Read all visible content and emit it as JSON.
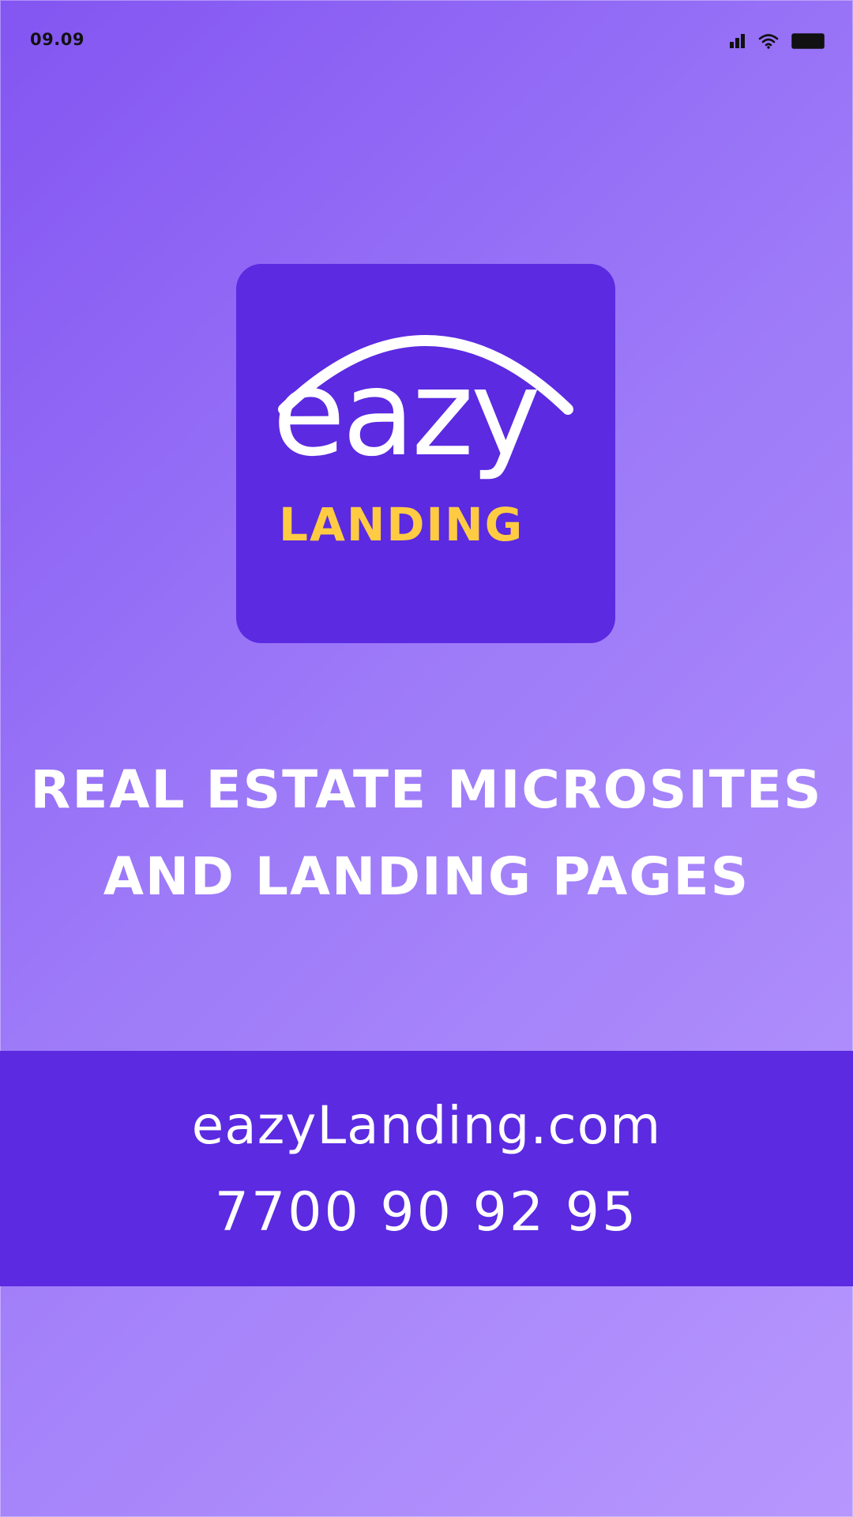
{
  "status_bar": {
    "time": "09.09",
    "icons": [
      "signal-icon",
      "wifi-icon",
      "battery-icon"
    ]
  },
  "logo": {
    "word": "eazy",
    "sub": "LANDING"
  },
  "headline": {
    "line1": "REAL ESTATE MICROSITES",
    "line2": "AND LANDING PAGES"
  },
  "contact": {
    "website": "eazyLanding.com",
    "phone": "7700 90 92 95"
  },
  "colors": {
    "background_start": "#8355f2",
    "background_end": "#b797fd",
    "brand_purple": "#5b2ae1",
    "accent_yellow": "#ffcb43",
    "text": "#ffffff"
  }
}
